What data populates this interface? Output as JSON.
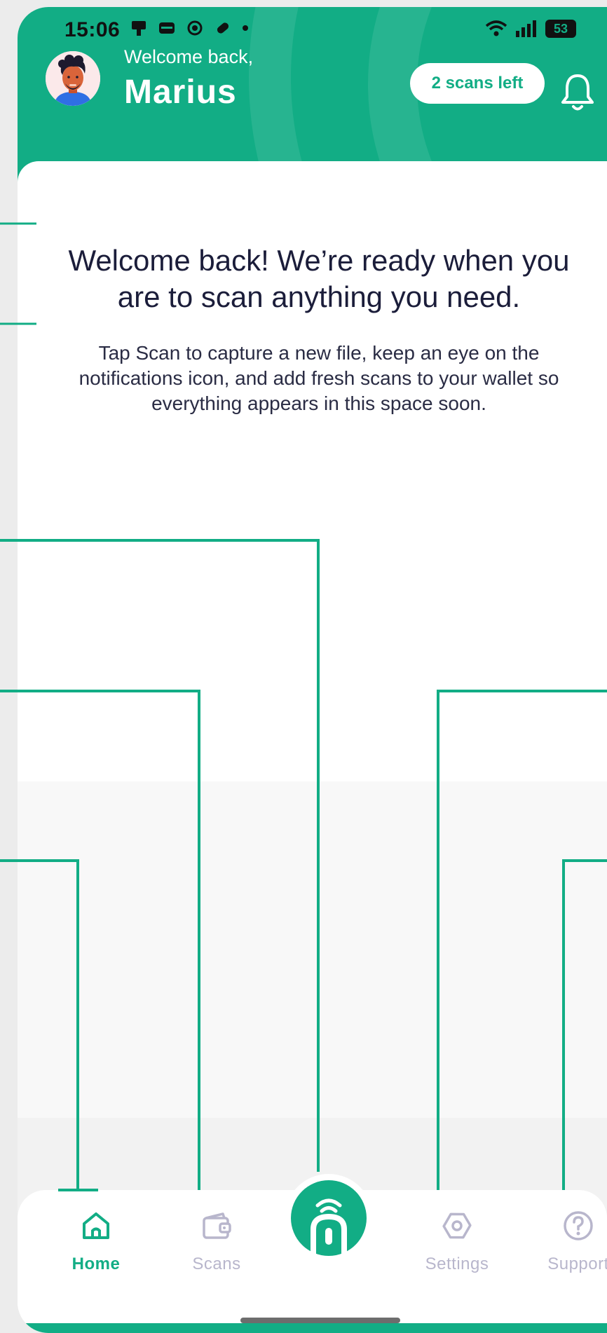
{
  "status_bar": {
    "time": "15:06",
    "battery": "53"
  },
  "header": {
    "greeting": "Welcome back,",
    "user_name": "Marius",
    "scans_badge": "2 scans left"
  },
  "main": {
    "headline": "Welcome back! We’re ready when you are to scan anything you need.",
    "body": "Tap Scan to capture a new file, keep an eye on the notifications icon, and add fresh scans to your wallet so everything appears in this space soon."
  },
  "tabbar": {
    "tabs": [
      {
        "label": "Home",
        "icon": "home-icon",
        "active": true
      },
      {
        "label": "Scans",
        "icon": "wallet-icon",
        "active": false
      },
      {
        "label": "Settings",
        "icon": "settings-icon",
        "active": false
      },
      {
        "label": "Support",
        "icon": "help-icon",
        "active": false
      }
    ],
    "scan_button_icon": "contactless-scan-icon"
  },
  "colors": {
    "brand": "#12ad85",
    "text_dark": "#1b1d3a",
    "tab_inactive": "#b8b6cc"
  }
}
